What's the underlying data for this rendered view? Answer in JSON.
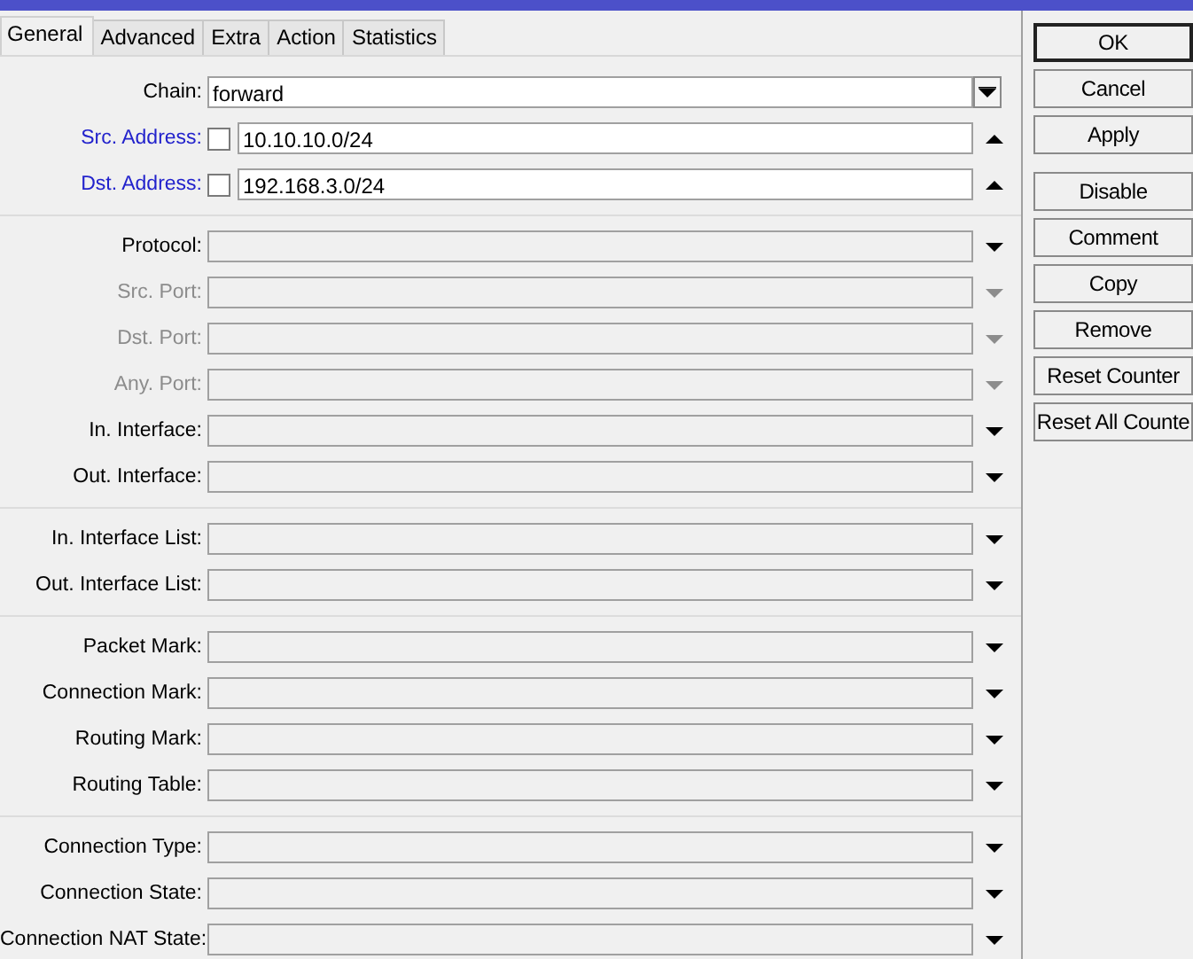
{
  "tabs": [
    {
      "label": "General",
      "selected": true
    },
    {
      "label": "Advanced",
      "selected": false
    },
    {
      "label": "Extra",
      "selected": false
    },
    {
      "label": "Action",
      "selected": false
    },
    {
      "label": "Statistics",
      "selected": false
    }
  ],
  "groups": [
    {
      "rows": [
        {
          "kind": "combo",
          "label": "Chain:",
          "value": "forward",
          "disabled": false
        },
        {
          "kind": "address",
          "label": "Src. Address:",
          "value": "10.10.10.0/24",
          "checked": false,
          "disabled": false
        },
        {
          "kind": "address",
          "label": "Dst. Address:",
          "value": "192.168.3.0/24",
          "checked": false,
          "disabled": false
        }
      ]
    },
    {
      "rows": [
        {
          "kind": "select",
          "label": "Protocol:",
          "disabled": false
        },
        {
          "kind": "select",
          "label": "Src. Port:",
          "disabled": true
        },
        {
          "kind": "select",
          "label": "Dst. Port:",
          "disabled": true
        },
        {
          "kind": "select",
          "label": "Any. Port:",
          "disabled": true
        },
        {
          "kind": "select",
          "label": "In. Interface:",
          "disabled": false
        },
        {
          "kind": "select",
          "label": "Out. Interface:",
          "disabled": false
        }
      ]
    },
    {
      "rows": [
        {
          "kind": "select",
          "label": "In. Interface List:",
          "disabled": false
        },
        {
          "kind": "select",
          "label": "Out. Interface List:",
          "disabled": false
        }
      ]
    },
    {
      "rows": [
        {
          "kind": "select",
          "label": "Packet Mark:",
          "disabled": false
        },
        {
          "kind": "select",
          "label": "Connection Mark:",
          "disabled": false
        },
        {
          "kind": "select",
          "label": "Routing Mark:",
          "disabled": false
        },
        {
          "kind": "select",
          "label": "Routing Table:",
          "disabled": false
        }
      ]
    },
    {
      "rows": [
        {
          "kind": "select",
          "label": "Connection Type:",
          "disabled": false
        },
        {
          "kind": "select",
          "label": "Connection State:",
          "disabled": false
        },
        {
          "kind": "select",
          "label": "Connection NAT State:",
          "disabled": false
        }
      ]
    }
  ],
  "button_groups": [
    {
      "buttons": [
        {
          "label": "OK",
          "default": true
        },
        {
          "label": "Cancel",
          "default": false
        },
        {
          "label": "Apply",
          "default": false
        }
      ]
    },
    {
      "buttons": [
        {
          "label": "Disable",
          "default": false
        },
        {
          "label": "Comment",
          "default": false
        },
        {
          "label": "Copy",
          "default": false
        },
        {
          "label": "Remove",
          "default": false
        },
        {
          "label": "Reset Counter",
          "default": false
        },
        {
          "label": "Reset All Counte",
          "default": false
        }
      ]
    }
  ]
}
